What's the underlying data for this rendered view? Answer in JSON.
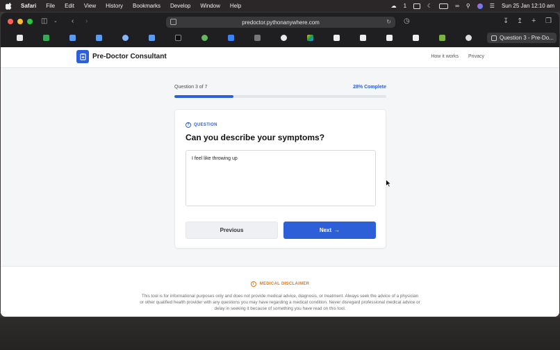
{
  "menubar": {
    "items": [
      "Safari",
      "File",
      "Edit",
      "View",
      "History",
      "Bookmarks",
      "Develop",
      "Window",
      "Help"
    ],
    "notification_count": "1",
    "datetime": "Sun 25 Jan  12:10 am"
  },
  "browser": {
    "url": "predoctor.pythonanywhere.com",
    "active_tab_title": "Question 3 - Pre-Do..."
  },
  "site": {
    "title": "Pre-Doctor Consultant",
    "nav": [
      "How it works",
      "Privacy"
    ]
  },
  "progress": {
    "label": "Question 3 of 7",
    "percent_text": "28% Complete",
    "fraction": 0.28
  },
  "question": {
    "tag": "QUESTION",
    "text": "Can you describe your symptoms?",
    "answer": "I feel like throwing up"
  },
  "buttons": {
    "previous": "Previous",
    "next": "Next"
  },
  "disclaimer": {
    "heading": "MEDICAL DISCLAIMER",
    "text": "This tool is for informational purposes only and does not provide medical advice, diagnosis, or treatment. Always seek the advice of a physician or other qualified health provider with any questions you may have regarding a medical condition. Never disregard professional medical advice or delay in seeking it because of something you have read on this tool."
  },
  "colors": {
    "brand": "#2d5fd8",
    "warning": "#d17a22"
  }
}
